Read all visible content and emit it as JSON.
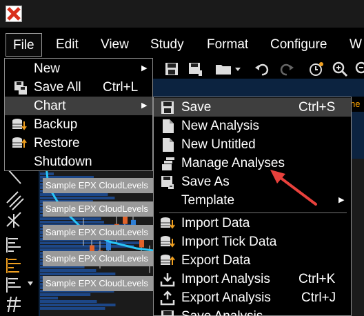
{
  "menubar": {
    "items": [
      {
        "label": "File"
      },
      {
        "label": "Edit"
      },
      {
        "label": "View"
      },
      {
        "label": "Study"
      },
      {
        "label": "Format"
      },
      {
        "label": "Configure"
      },
      {
        "label": "W"
      }
    ]
  },
  "file_menu": {
    "items": [
      {
        "label": "New",
        "shortcut": "",
        "submenu": true
      },
      {
        "label": "Save All",
        "shortcut": "Ctrl+L",
        "submenu": false
      },
      {
        "label": "Chart",
        "shortcut": "",
        "submenu": true
      },
      {
        "label": "Backup",
        "shortcut": "",
        "submenu": false
      },
      {
        "label": "Restore",
        "shortcut": "",
        "submenu": false
      },
      {
        "label": "Shutdown",
        "shortcut": "",
        "submenu": false
      }
    ]
  },
  "chart_menu": {
    "items": [
      {
        "label": "Save",
        "shortcut": "Ctrl+S"
      },
      {
        "label": "New Analysis",
        "shortcut": ""
      },
      {
        "label": "New Untitled",
        "shortcut": ""
      },
      {
        "label": "Manage Analyses",
        "shortcut": ""
      },
      {
        "label": "Save As",
        "shortcut": ""
      },
      {
        "label": "Template",
        "shortcut": ""
      },
      {
        "label": "Import Data",
        "shortcut": ""
      },
      {
        "label": "Import Tick Data",
        "shortcut": ""
      },
      {
        "label": "Export Data",
        "shortcut": ""
      },
      {
        "label": "Import Analysis",
        "shortcut": "Ctrl+K"
      },
      {
        "label": "Export Analysis",
        "shortcut": "Ctrl+J"
      },
      {
        "label": "Save Analysis",
        "shortcut": ""
      }
    ]
  },
  "chart": {
    "study_label": "Sample EPX CloudLevels",
    "side_text": "ne"
  },
  "colors": {
    "highlight": "#3e3e3e",
    "chart_bg": "#0c2340",
    "annotation_arrow": "#e8413c",
    "price_line": "#29c5f6",
    "candle_up": "#2e7fd6",
    "candle_down": "#e0622a"
  }
}
